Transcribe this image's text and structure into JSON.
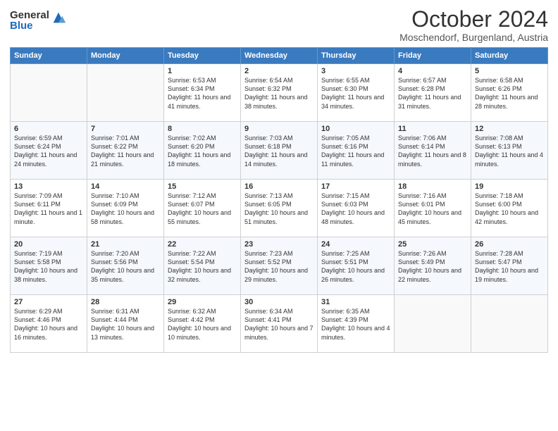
{
  "logo": {
    "general": "General",
    "blue": "Blue"
  },
  "header": {
    "month": "October 2024",
    "location": "Moschendorf, Burgenland, Austria"
  },
  "weekdays": [
    "Sunday",
    "Monday",
    "Tuesday",
    "Wednesday",
    "Thursday",
    "Friday",
    "Saturday"
  ],
  "weeks": [
    [
      {
        "day": "",
        "sunrise": "",
        "sunset": "",
        "daylight": ""
      },
      {
        "day": "",
        "sunrise": "",
        "sunset": "",
        "daylight": ""
      },
      {
        "day": "1",
        "sunrise": "Sunrise: 6:53 AM",
        "sunset": "Sunset: 6:34 PM",
        "daylight": "Daylight: 11 hours and 41 minutes."
      },
      {
        "day": "2",
        "sunrise": "Sunrise: 6:54 AM",
        "sunset": "Sunset: 6:32 PM",
        "daylight": "Daylight: 11 hours and 38 minutes."
      },
      {
        "day": "3",
        "sunrise": "Sunrise: 6:55 AM",
        "sunset": "Sunset: 6:30 PM",
        "daylight": "Daylight: 11 hours and 34 minutes."
      },
      {
        "day": "4",
        "sunrise": "Sunrise: 6:57 AM",
        "sunset": "Sunset: 6:28 PM",
        "daylight": "Daylight: 11 hours and 31 minutes."
      },
      {
        "day": "5",
        "sunrise": "Sunrise: 6:58 AM",
        "sunset": "Sunset: 6:26 PM",
        "daylight": "Daylight: 11 hours and 28 minutes."
      }
    ],
    [
      {
        "day": "6",
        "sunrise": "Sunrise: 6:59 AM",
        "sunset": "Sunset: 6:24 PM",
        "daylight": "Daylight: 11 hours and 24 minutes."
      },
      {
        "day": "7",
        "sunrise": "Sunrise: 7:01 AM",
        "sunset": "Sunset: 6:22 PM",
        "daylight": "Daylight: 11 hours and 21 minutes."
      },
      {
        "day": "8",
        "sunrise": "Sunrise: 7:02 AM",
        "sunset": "Sunset: 6:20 PM",
        "daylight": "Daylight: 11 hours and 18 minutes."
      },
      {
        "day": "9",
        "sunrise": "Sunrise: 7:03 AM",
        "sunset": "Sunset: 6:18 PM",
        "daylight": "Daylight: 11 hours and 14 minutes."
      },
      {
        "day": "10",
        "sunrise": "Sunrise: 7:05 AM",
        "sunset": "Sunset: 6:16 PM",
        "daylight": "Daylight: 11 hours and 11 minutes."
      },
      {
        "day": "11",
        "sunrise": "Sunrise: 7:06 AM",
        "sunset": "Sunset: 6:14 PM",
        "daylight": "Daylight: 11 hours and 8 minutes."
      },
      {
        "day": "12",
        "sunrise": "Sunrise: 7:08 AM",
        "sunset": "Sunset: 6:13 PM",
        "daylight": "Daylight: 11 hours and 4 minutes."
      }
    ],
    [
      {
        "day": "13",
        "sunrise": "Sunrise: 7:09 AM",
        "sunset": "Sunset: 6:11 PM",
        "daylight": "Daylight: 11 hours and 1 minute."
      },
      {
        "day": "14",
        "sunrise": "Sunrise: 7:10 AM",
        "sunset": "Sunset: 6:09 PM",
        "daylight": "Daylight: 10 hours and 58 minutes."
      },
      {
        "day": "15",
        "sunrise": "Sunrise: 7:12 AM",
        "sunset": "Sunset: 6:07 PM",
        "daylight": "Daylight: 10 hours and 55 minutes."
      },
      {
        "day": "16",
        "sunrise": "Sunrise: 7:13 AM",
        "sunset": "Sunset: 6:05 PM",
        "daylight": "Daylight: 10 hours and 51 minutes."
      },
      {
        "day": "17",
        "sunrise": "Sunrise: 7:15 AM",
        "sunset": "Sunset: 6:03 PM",
        "daylight": "Daylight: 10 hours and 48 minutes."
      },
      {
        "day": "18",
        "sunrise": "Sunrise: 7:16 AM",
        "sunset": "Sunset: 6:01 PM",
        "daylight": "Daylight: 10 hours and 45 minutes."
      },
      {
        "day": "19",
        "sunrise": "Sunrise: 7:18 AM",
        "sunset": "Sunset: 6:00 PM",
        "daylight": "Daylight: 10 hours and 42 minutes."
      }
    ],
    [
      {
        "day": "20",
        "sunrise": "Sunrise: 7:19 AM",
        "sunset": "Sunset: 5:58 PM",
        "daylight": "Daylight: 10 hours and 38 minutes."
      },
      {
        "day": "21",
        "sunrise": "Sunrise: 7:20 AM",
        "sunset": "Sunset: 5:56 PM",
        "daylight": "Daylight: 10 hours and 35 minutes."
      },
      {
        "day": "22",
        "sunrise": "Sunrise: 7:22 AM",
        "sunset": "Sunset: 5:54 PM",
        "daylight": "Daylight: 10 hours and 32 minutes."
      },
      {
        "day": "23",
        "sunrise": "Sunrise: 7:23 AM",
        "sunset": "Sunset: 5:52 PM",
        "daylight": "Daylight: 10 hours and 29 minutes."
      },
      {
        "day": "24",
        "sunrise": "Sunrise: 7:25 AM",
        "sunset": "Sunset: 5:51 PM",
        "daylight": "Daylight: 10 hours and 26 minutes."
      },
      {
        "day": "25",
        "sunrise": "Sunrise: 7:26 AM",
        "sunset": "Sunset: 5:49 PM",
        "daylight": "Daylight: 10 hours and 22 minutes."
      },
      {
        "day": "26",
        "sunrise": "Sunrise: 7:28 AM",
        "sunset": "Sunset: 5:47 PM",
        "daylight": "Daylight: 10 hours and 19 minutes."
      }
    ],
    [
      {
        "day": "27",
        "sunrise": "Sunrise: 6:29 AM",
        "sunset": "Sunset: 4:46 PM",
        "daylight": "Daylight: 10 hours and 16 minutes."
      },
      {
        "day": "28",
        "sunrise": "Sunrise: 6:31 AM",
        "sunset": "Sunset: 4:44 PM",
        "daylight": "Daylight: 10 hours and 13 minutes."
      },
      {
        "day": "29",
        "sunrise": "Sunrise: 6:32 AM",
        "sunset": "Sunset: 4:42 PM",
        "daylight": "Daylight: 10 hours and 10 minutes."
      },
      {
        "day": "30",
        "sunrise": "Sunrise: 6:34 AM",
        "sunset": "Sunset: 4:41 PM",
        "daylight": "Daylight: 10 hours and 7 minutes."
      },
      {
        "day": "31",
        "sunrise": "Sunrise: 6:35 AM",
        "sunset": "Sunset: 4:39 PM",
        "daylight": "Daylight: 10 hours and 4 minutes."
      },
      {
        "day": "",
        "sunrise": "",
        "sunset": "",
        "daylight": ""
      },
      {
        "day": "",
        "sunrise": "",
        "sunset": "",
        "daylight": ""
      }
    ]
  ]
}
